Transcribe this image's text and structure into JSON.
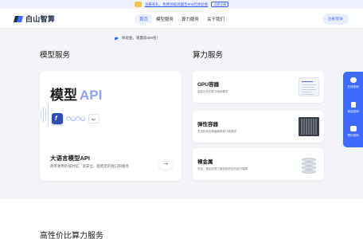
{
  "promo": {
    "text": "注册有礼，免费领取高额至800元体验金",
    "button": "立即注册"
  },
  "nav": {
    "brand": "白山智算",
    "items": [
      {
        "label": "首页",
        "active": true
      },
      {
        "label": "模型服务",
        "active": false
      },
      {
        "label": "算力服务",
        "active": false
      },
      {
        "label": "关于我们",
        "active": false
      }
    ],
    "login": "注册/登录"
  },
  "notice": "体验金，限量前500名！",
  "sections": {
    "model": "模型服务",
    "compute": "算力服务",
    "bottom": "高性价比算力服务"
  },
  "model_card": {
    "hero_zh": "模型",
    "hero_api": "API",
    "chip_logo": "f",
    "chip_text": "api",
    "title": "大语言模型API",
    "desc": "简单易用的低时延、高安全、超稳定的接口和服务",
    "arrow": "→"
  },
  "compute_cards": [
    {
      "title": "GPU容器",
      "desc": "高性价比的算卡租用服务",
      "icon": "console-screenshot-icon"
    },
    {
      "title": "弹性容器",
      "desc": "灵活的动态伸缩和精准计费服务",
      "icon": "server-rack-icon"
    },
    {
      "title": "裸金属",
      "desc": "安全、稳定的算力服务和完全的运行保障",
      "icon": "disk-stack-icon"
    }
  ],
  "sidebar": [
    {
      "label": "在线咨询",
      "icon": "chat-bubble-icon"
    },
    {
      "label": "电话咨询",
      "icon": "phone-icon"
    },
    {
      "label": "预约咨询",
      "icon": "calendar-icon"
    }
  ],
  "colors": {
    "accent": "#3d6bff",
    "promo_bg": "#eef1ff",
    "page_bg": "#f3f4f7",
    "api_text": "#8fa0ff"
  }
}
